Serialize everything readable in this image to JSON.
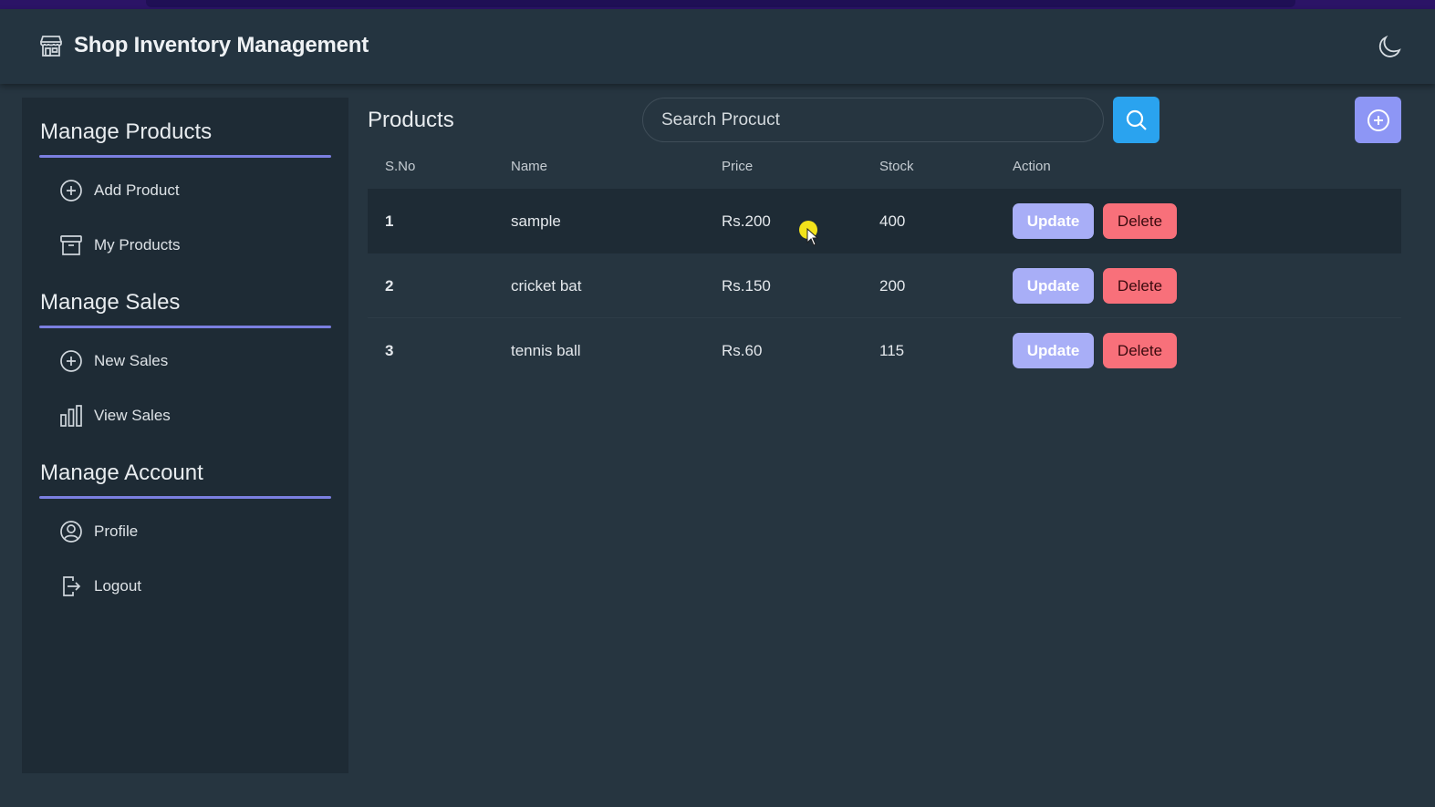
{
  "app": {
    "title": "Shop Inventory Management"
  },
  "sidebar": {
    "sections": [
      {
        "title": "Manage Products",
        "items": [
          {
            "label": "Add Product",
            "icon": "plus-circle-icon"
          },
          {
            "label": "My Products",
            "icon": "archive-box-icon"
          }
        ]
      },
      {
        "title": "Manage Sales",
        "items": [
          {
            "label": "New Sales",
            "icon": "plus-circle-icon"
          },
          {
            "label": "View Sales",
            "icon": "bar-chart-icon"
          }
        ]
      },
      {
        "title": "Manage Account",
        "items": [
          {
            "label": "Profile",
            "icon": "user-circle-icon"
          },
          {
            "label": "Logout",
            "icon": "logout-icon"
          }
        ]
      }
    ]
  },
  "main": {
    "title": "Products",
    "search": {
      "placeholder": "Search Procuct"
    },
    "table": {
      "headers": [
        "S.No",
        "Name",
        "Price",
        "Stock",
        "Action"
      ],
      "rows": [
        {
          "sno": "1",
          "name": "sample",
          "price": "Rs.200",
          "stock": "400"
        },
        {
          "sno": "2",
          "name": "cricket bat",
          "price": "Rs.150",
          "stock": "200"
        },
        {
          "sno": "3",
          "name": "tennis ball",
          "price": "Rs.60",
          "stock": "115"
        }
      ],
      "actions": {
        "update": "Update",
        "delete": "Delete"
      }
    }
  },
  "colors": {
    "accent": "#7b7fe0",
    "search_button": "#2aa3ef",
    "update_button": "#a8aef7",
    "delete_button": "#f8707a"
  }
}
